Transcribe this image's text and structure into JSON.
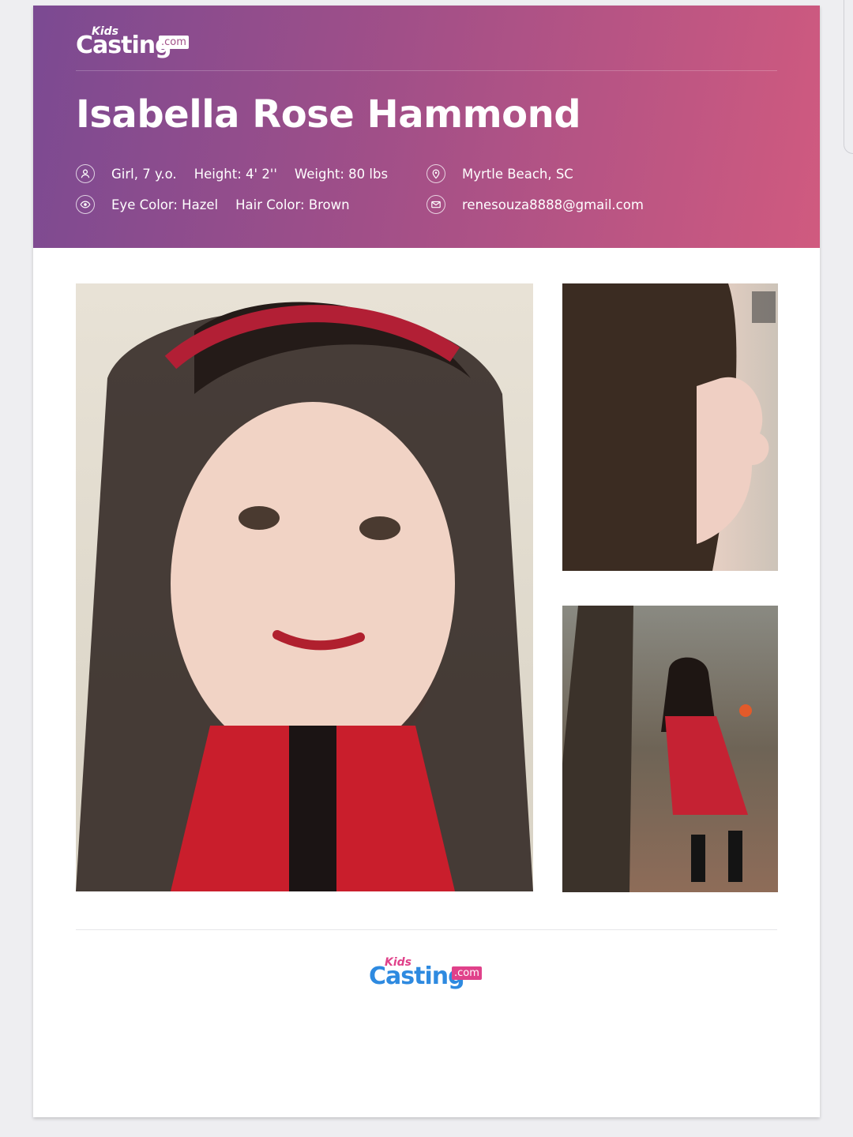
{
  "logo": {
    "kids": "Kids",
    "casting": "Casting",
    "com": ".com"
  },
  "profile": {
    "name": "Isabella Rose Hammond",
    "basic": "Girl, 7 y.o.",
    "height": "Height: 4' 2''",
    "weight": "Weight: 80 lbs",
    "eye_color": "Eye Color: Hazel",
    "hair_color": "Hair Color: Brown",
    "location": "Myrtle Beach, SC",
    "email": "renesouza8888@gmail.com"
  },
  "icons": {
    "person": "person-icon",
    "eye": "eye-icon",
    "location": "location-pin-icon",
    "email": "envelope-icon"
  },
  "photos": [
    {
      "name": "portrait-photo"
    },
    {
      "name": "profile-photo"
    },
    {
      "name": "full-body-photo"
    }
  ],
  "colors": {
    "header_start": "#7b4a92",
    "header_end": "#d05a7f",
    "logo_blue": "#2e8ae0",
    "logo_pink": "#e0418a"
  }
}
